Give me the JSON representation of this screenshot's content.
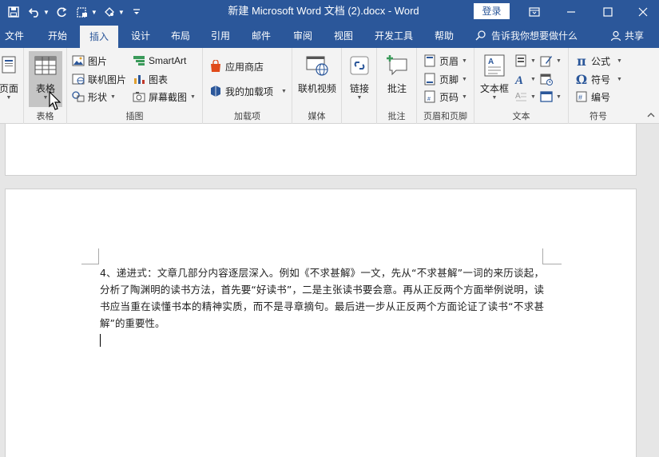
{
  "window": {
    "title": "新建 Microsoft Word 文档 (2).docx  -  Word",
    "login_label": "登录"
  },
  "tabs": [
    "文件",
    "开始",
    "插入",
    "设计",
    "布局",
    "引用",
    "邮件",
    "审阅",
    "视图",
    "开发工具",
    "帮助"
  ],
  "active_tab": "插入",
  "tellme": "告诉我你想要做什么",
  "share_label": "共享",
  "ribbon": {
    "pages": {
      "label": "页面",
      "group": ""
    },
    "tables": {
      "label": "表格",
      "group": "表格"
    },
    "illustrations": {
      "group": "插图",
      "picture": "图片",
      "online_picture": "联机图片",
      "shapes": "形状",
      "smartart": "SmartArt",
      "chart": "图表",
      "screenshot": "屏幕截图"
    },
    "addins": {
      "group": "加载项",
      "store": "应用商店",
      "my_addins": "我的加载项"
    },
    "media": {
      "group": "媒体",
      "online_video": "联机视频"
    },
    "links": {
      "label": "链接"
    },
    "comments": {
      "group": "批注",
      "comment": "批注"
    },
    "header_footer": {
      "group": "页眉和页脚",
      "header": "页眉",
      "footer": "页脚",
      "page_number": "页码"
    },
    "text": {
      "group": "文本",
      "textbox": "文本框"
    },
    "symbols": {
      "group": "符号",
      "equation": "公式",
      "symbol": "符号",
      "number": "编号"
    }
  },
  "document": {
    "paragraph": "4、递进式：文章几部分内容逐层深入。例如《不求甚解》一文，先从“不求甚解”一词的来历谈起，分析了陶渊明的读书方法，首先要“好读书”，二是主张读书要会意。再从正反两个方面举例说明，读书应当重在读懂书本的精神实质，而不是寻章摘句。最后进一步从正反两个方面论证了读书“不求甚解”的重要性。"
  },
  "colors": {
    "accent": "#2b579a",
    "ribbon_bg": "#f3f3f3",
    "workspace_bg": "#e6e6e6"
  }
}
